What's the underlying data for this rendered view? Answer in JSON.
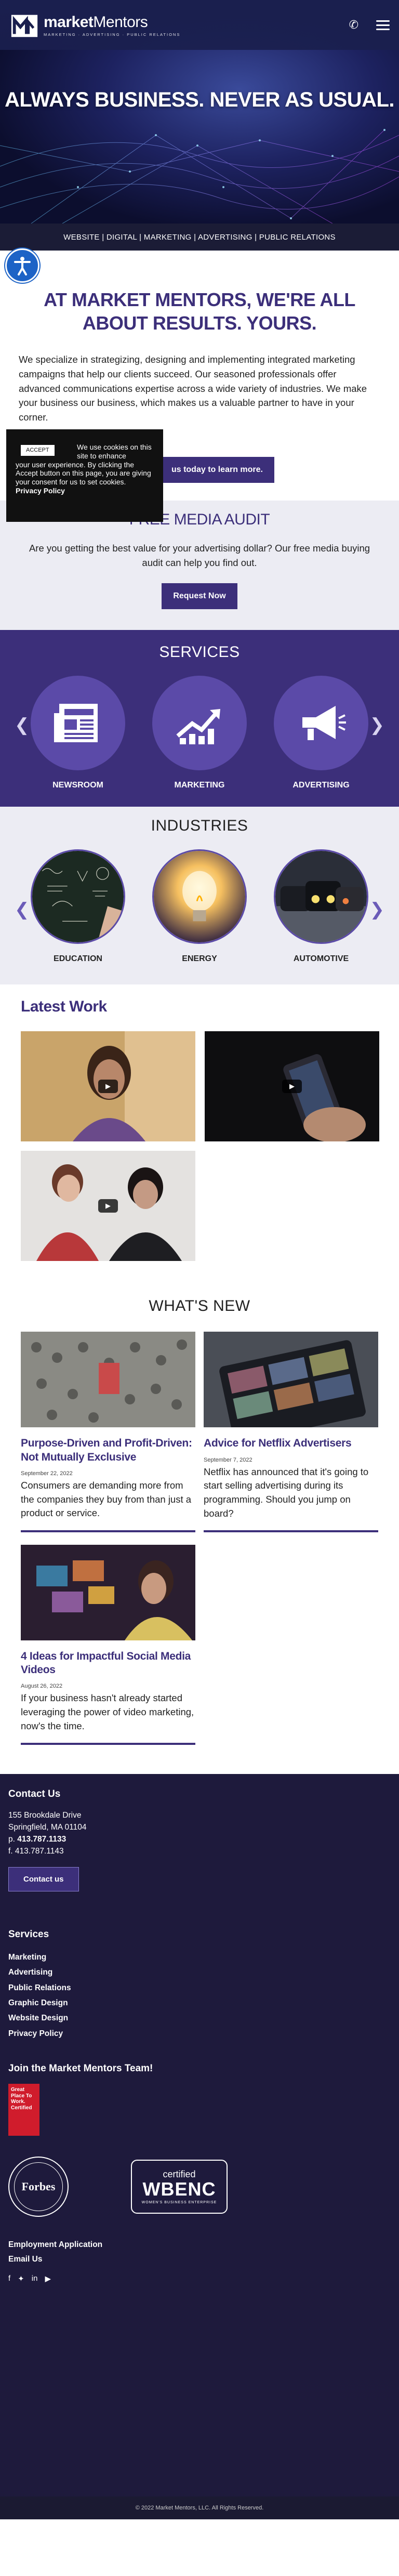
{
  "header": {
    "logo_name_bold": "market",
    "logo_name_regular": "Mentors",
    "logo_sub": "MARKETING  ·  ADVERTISING  ·  PUBLIC RELATIONS",
    "phone_icon": "phone-icon",
    "menu_icon": "hamburger-menu-icon"
  },
  "hero": {
    "tagline": "ALWAYS BUSINESS. NEVER AS USUAL."
  },
  "services_bar": "WEBSITE | DIGITAL | MARKETING | ADVERTISING | PUBLIC RELATIONS",
  "intro": {
    "title": "AT MARKET MENTORS, WE'RE ALL ABOUT RESULTS. YOURS.",
    "body": "We specialize in strategizing, designing and implementing integrated marketing campaigns that help our clients succeed. Our seasoned professionals offer advanced communications expertise across a wide variety of industries. We make your business our business, which makes us a valuable partner to have in your corner.",
    "cta_label": "us today to learn more."
  },
  "cookie": {
    "accept_label": "ACCEPT",
    "text_a": "We use cookies on this site to enhance",
    "text_b": "your user experience. By clicking the Accept button on this page, you are giving your consent for us to set cookies.",
    "policy_label": "Privacy Policy"
  },
  "audit": {
    "title": "FREE MEDIA AUDIT",
    "body": "Are you getting the best value for your advertising dollar? Our free media buying audit can help you find out.",
    "button": "Request Now"
  },
  "services": {
    "title": "SERVICES",
    "items": [
      {
        "label": "NEWSROOM",
        "icon": "newspaper-icon"
      },
      {
        "label": "MARKETING",
        "icon": "growth-chart-icon"
      },
      {
        "label": "ADVERTISING",
        "icon": "megaphone-icon"
      }
    ]
  },
  "industries": {
    "title": "INDUSTRIES",
    "items": [
      {
        "label": "EDUCATION"
      },
      {
        "label": "ENERGY"
      },
      {
        "label": "AUTOMOTIVE"
      }
    ]
  },
  "work": {
    "title": "Latest Work"
  },
  "news": {
    "title": "WHAT'S NEW",
    "posts": [
      {
        "title": "Purpose-Driven and Profit-Driven: Not Mutually Exclusive",
        "date": "September 22, 2022",
        "excerpt": "Consumers are demanding more from the companies they buy from than just a product or service."
      },
      {
        "title": "Advice for Netflix Advertisers",
        "date": "September 7, 2022",
        "excerpt": "Netflix has announced that it's going to start selling advertising during its programming. Should you jump on board?"
      },
      {
        "title": "4 Ideas for Impactful Social Media Videos",
        "date": "August 26, 2022",
        "excerpt": "If your business hasn't already started leveraging the power of video marketing, now's the time."
      }
    ]
  },
  "footer": {
    "contact_title": "Contact Us",
    "address1": "155 Brookdale Drive",
    "address2": "Springfield, MA 01104",
    "phone_prefix": "p.",
    "phone": "413.787.1133",
    "fax": "f. 413.787.1143",
    "contact_button": "Contact us",
    "services_title": "Services",
    "services_links": [
      "Marketing",
      "Advertising",
      "Public Relations",
      "Graphic Design",
      "Website Design",
      "Privacy Policy"
    ],
    "team_title": "Join the Market Mentors Team!",
    "gptw_text": "Great Place To Work. Certified",
    "forbes_text": "Forbes",
    "wbenc_certified": "certified",
    "wbenc_name": "WBENC",
    "wbenc_sub": "WOMEN'S BUSINESS ENTERPRISE",
    "employment": "Employment Application",
    "email": "Email Us"
  },
  "copyright": "© 2022 Market Mentors, LLC. All Rights Reserved."
}
